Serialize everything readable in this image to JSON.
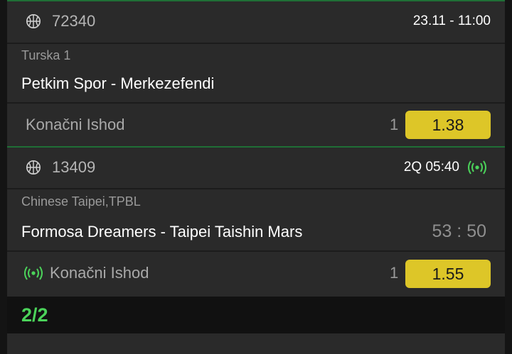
{
  "colors": {
    "accent": "#4bd35a",
    "odds_button": "#ddc628",
    "card_bg": "#2a2a2a",
    "page_bg": "#141414",
    "separator": "#1f6f36"
  },
  "events": [
    {
      "sport_icon": "basketball-icon",
      "code": "72340",
      "time": "23.11  -  11:00",
      "league": "Turska 1",
      "teams": "Petkim Spor - Merkezefendi",
      "market": "Konačni Ishod",
      "outcome": "1",
      "odd": "1.38"
    },
    {
      "sport_icon": "basketball-icon",
      "code": "13409",
      "time": "2Q  05:40",
      "live_icon": "live-broadcast-icon",
      "league": "Chinese Taipei,TPBL",
      "teams": "Formosa Dreamers - Taipei Taishin Mars",
      "score": "53 : 50",
      "market": "Konačni Ishod",
      "outcome": "1",
      "odd": "1.55"
    }
  ],
  "footer": {
    "counter": "2/2"
  }
}
